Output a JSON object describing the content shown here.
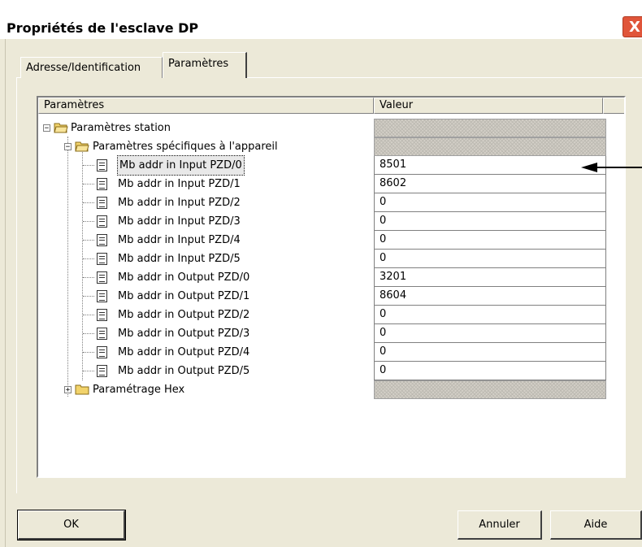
{
  "window": {
    "title": "Propriétés de l'esclave DP",
    "close_glyph": "X"
  },
  "tabs": [
    {
      "label": "Adresse/Identification",
      "active": false
    },
    {
      "label": "Paramètres",
      "active": true
    }
  ],
  "list": {
    "columns": [
      "Paramètres",
      "Valeur"
    ],
    "station_label": "Paramètres station",
    "device_label": "Paramètres spécifiques à l'appareil",
    "hex_label": "Paramétrage Hex",
    "items": [
      {
        "label": "Mb addr in Input PZD/0",
        "value": "8501"
      },
      {
        "label": "Mb addr in Input PZD/1",
        "value": "8602"
      },
      {
        "label": "Mb addr in Input PZD/2",
        "value": "0"
      },
      {
        "label": "Mb addr in Input PZD/3",
        "value": "0"
      },
      {
        "label": "Mb addr in Input PZD/4",
        "value": "0"
      },
      {
        "label": "Mb addr in Input PZD/5",
        "value": "0"
      },
      {
        "label": "Mb addr in Output PZD/0",
        "value": "3201"
      },
      {
        "label": "Mb addr in Output PZD/1",
        "value": "8604"
      },
      {
        "label": "Mb addr in Output PZD/2",
        "value": "0"
      },
      {
        "label": "Mb addr in Output PZD/3",
        "value": "0"
      },
      {
        "label": "Mb addr in Output PZD/4",
        "value": "0"
      },
      {
        "label": "Mb addr in Output PZD/5",
        "value": "0"
      }
    ]
  },
  "buttons": {
    "ok": "OK",
    "cancel": "Annuler",
    "help": "Aide"
  },
  "colors": {
    "dialog_bg": "#ece9d8",
    "close_red": "#e0553a",
    "folder_yellow": "#f2d36b"
  }
}
